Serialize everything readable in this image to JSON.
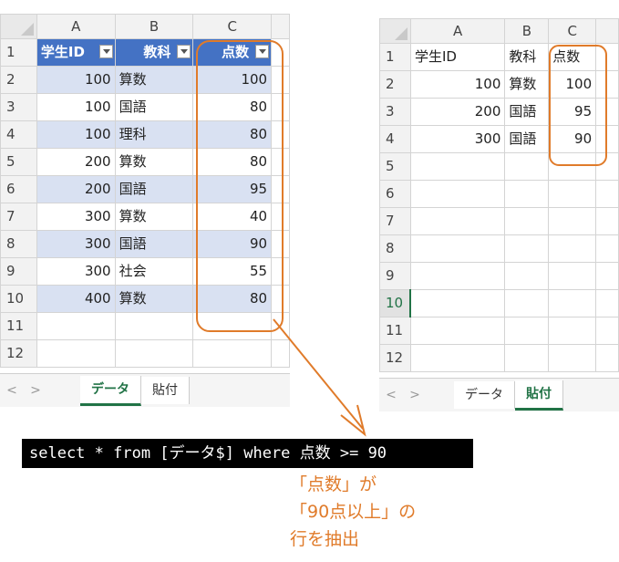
{
  "left_sheet": {
    "columns": [
      "A",
      "B",
      "C"
    ],
    "headers": [
      "学生ID",
      "教科",
      "点数"
    ],
    "rows": [
      [
        "100",
        "算数",
        "100"
      ],
      [
        "100",
        "国語",
        "80"
      ],
      [
        "100",
        "理科",
        "80"
      ],
      [
        "200",
        "算数",
        "80"
      ],
      [
        "200",
        "国語",
        "95"
      ],
      [
        "300",
        "算数",
        "40"
      ],
      [
        "300",
        "国語",
        "90"
      ],
      [
        "300",
        "社会",
        "55"
      ],
      [
        "400",
        "算数",
        "80"
      ]
    ],
    "row_numbers": [
      "1",
      "2",
      "3",
      "4",
      "5",
      "6",
      "7",
      "8",
      "9",
      "10",
      "11",
      "12"
    ],
    "tabs": [
      "データ",
      "貼付"
    ],
    "active_tab": "データ",
    "header_color": "#4472c4",
    "band_color": "#d9e1f2"
  },
  "right_sheet": {
    "columns": [
      "A",
      "B",
      "C"
    ],
    "headers": [
      "学生ID",
      "教科",
      "点数"
    ],
    "rows": [
      [
        "100",
        "算数",
        "100"
      ],
      [
        "200",
        "国語",
        "95"
      ],
      [
        "300",
        "国語",
        "90"
      ]
    ],
    "row_numbers": [
      "1",
      "2",
      "3",
      "4",
      "5",
      "6",
      "7",
      "8",
      "9",
      "10",
      "11",
      "12"
    ],
    "selected_row": "10",
    "tabs": [
      "データ",
      "貼付"
    ],
    "active_tab": "貼付"
  },
  "sql": "select * from [データ$] where 点数 >= 90",
  "note_lines": [
    "「点数」が",
    "「90点以上」の",
    "行を抽出"
  ],
  "nav": {
    "prev": "<",
    "next": ">"
  },
  "accent_color": "#e07b2a"
}
